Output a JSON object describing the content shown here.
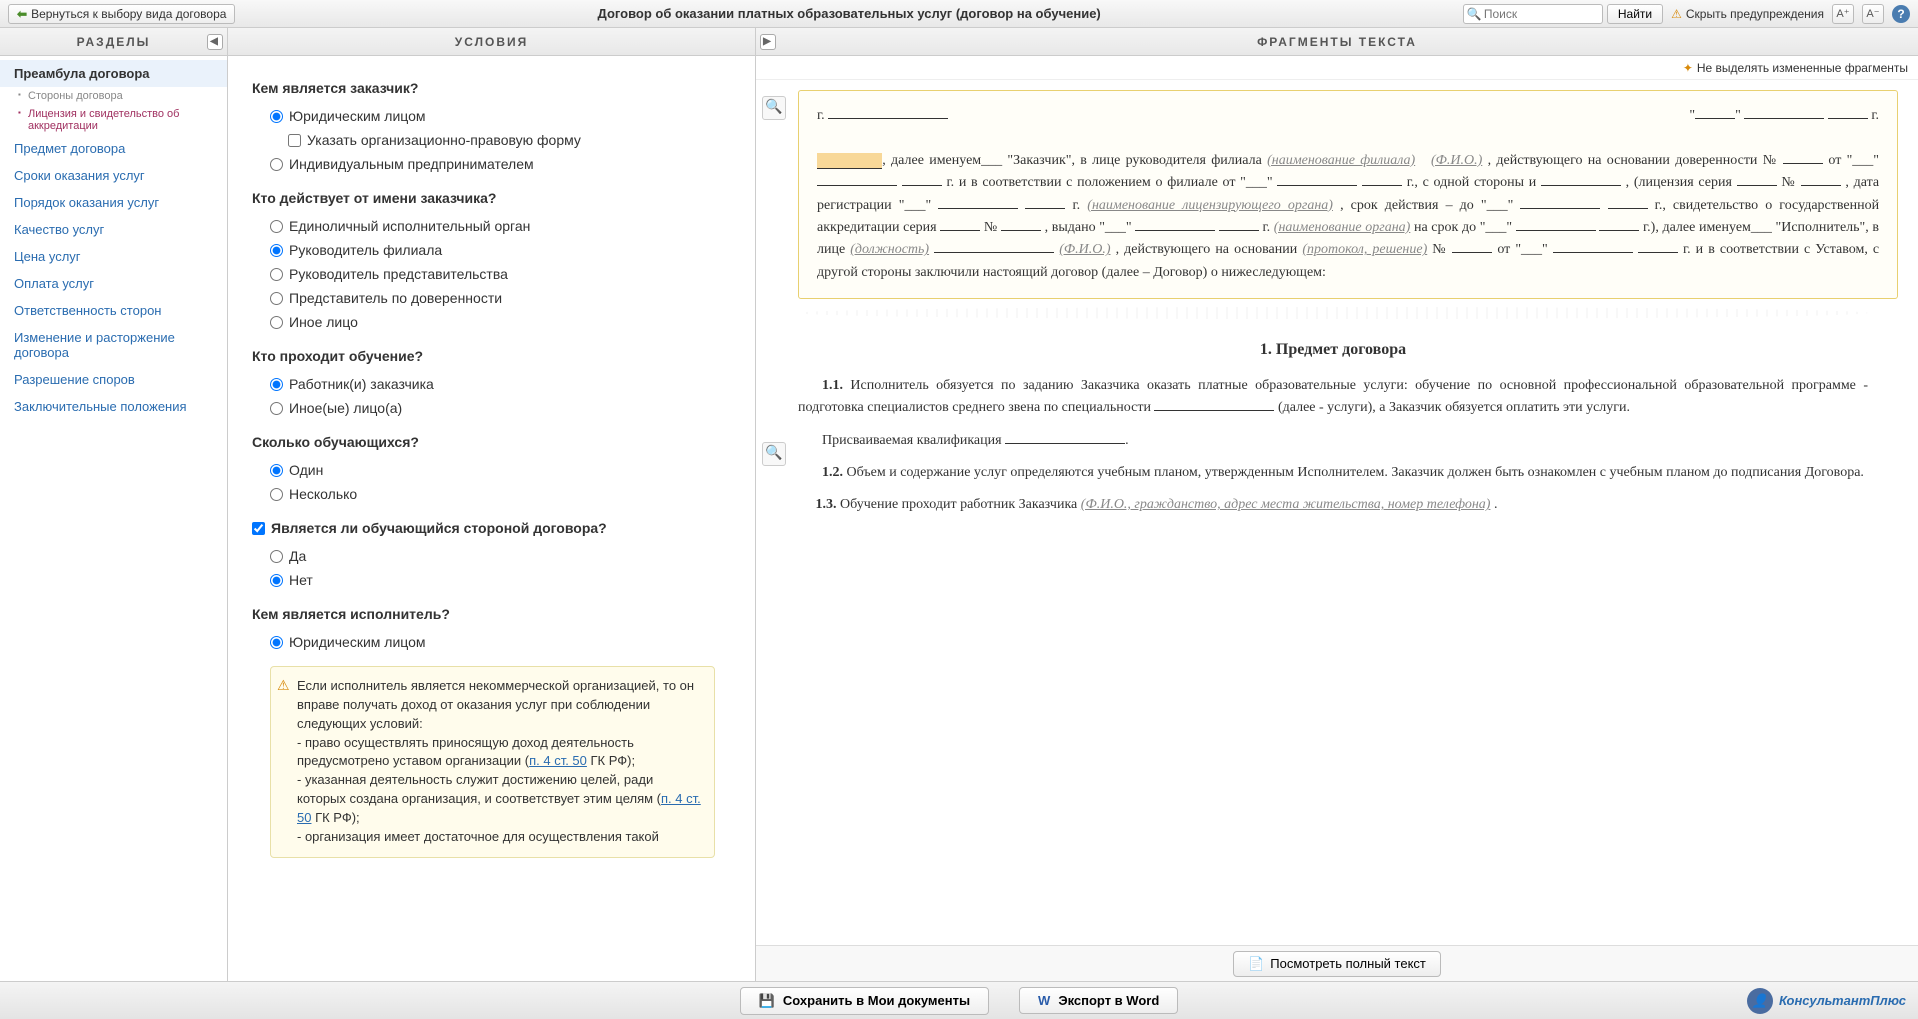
{
  "toolbar": {
    "back": "Вернуться к выбору вида договора",
    "title": "Договор об оказании платных образовательных услуг (договор на обучение)",
    "search_placeholder": "Поиск",
    "find": "Найти",
    "hide_warnings": "Скрыть предупреждения"
  },
  "panels": {
    "sections": "РАЗДЕЛЫ",
    "conditions": "УСЛОВИЯ",
    "fragments": "ФРАГМЕНТЫ ТЕКСТА"
  },
  "sections": {
    "items": [
      {
        "label": "Преамбула договора",
        "active": true
      },
      {
        "label": "Предмет договора"
      },
      {
        "label": "Сроки оказания услуг"
      },
      {
        "label": "Порядок оказания услуг"
      },
      {
        "label": "Качество услуг"
      },
      {
        "label": "Цена услуг"
      },
      {
        "label": "Оплата услуг"
      },
      {
        "label": "Ответственность сторон"
      },
      {
        "label": "Изменение и расторжение договора"
      },
      {
        "label": "Разрешение споров"
      },
      {
        "label": "Заключительные положения"
      }
    ],
    "subsections": [
      {
        "label": "Стороны договора"
      },
      {
        "label": "Лицензия и свидетельство об аккредитации",
        "active": true
      }
    ]
  },
  "conditions": {
    "q1": "Кем является заказчик?",
    "q1_opts": [
      "Юридическим лицом",
      "Индивидуальным предпринимателем"
    ],
    "q1_sub": "Указать организационно-правовую форму",
    "q2": "Кто действует от имени заказчика?",
    "q2_opts": [
      "Единоличный исполнительный орган",
      "Руководитель филиала",
      "Руководитель представительства",
      "Представитель по доверенности",
      "Иное лицо"
    ],
    "q3": "Кто проходит обучение?",
    "q3_opts": [
      "Работник(и) заказчика",
      "Иное(ые) лицо(а)"
    ],
    "q4": "Сколько обучающихся?",
    "q4_opts": [
      "Один",
      "Несколько"
    ],
    "q5": "Является ли обучающийся стороной договора?",
    "q5_opts": [
      "Да",
      "Нет"
    ],
    "q6": "Кем является исполнитель?",
    "q6_opts": [
      "Юридическим лицом"
    ],
    "warning": {
      "intro": "Если исполнитель является некоммерческой организацией, то он вправе получать доход от оказания услуг при соблюдении следующих условий:",
      "li1": "- право осуществлять приносящую доход деятельность предусмотрено уставом организации (",
      "link1": "п. 4 ст. 50",
      "li1_end": " ГК РФ);",
      "li2": "- указанная деятельность служит достижению целей, ради которых создана организация, и соответствует этим целям (",
      "link2": "п. 4 ст. 50",
      "li2_end": " ГК РФ);",
      "li3": "- организация имеет достаточное для осуществления такой"
    }
  },
  "fragments": {
    "no_highlight": "Не выделять измененные фрагменты",
    "city_prefix": "г.",
    "year_suffix": "г.",
    "t1": ", далее именуем___ \"Заказчик\", в лице руководителя филиала",
    "ph_branch": "(наименование филиала)",
    "ph_fio": "(Ф.И.О.)",
    "t2": ", действующего на основании доверенности №",
    "t2a": "от \"___\"",
    "t2b": "г. и  в соответствии с положением о филиале от \"___\"",
    "t2c": "г., с одной стороны и",
    "t2d": ", (лицензия серия",
    "t2e": "№",
    "t2f": ", дата регистрации \"___\"",
    "t2g": "г.",
    "ph_license": "(наименование лицензирующего органа)",
    "t3": ", срок действия – до \"___\"",
    "t3a": "г., свидетельство о государственной аккредитации серия",
    "t3b": "№",
    "t3c": ", выдано \"___\"",
    "t3d": "г.",
    "ph_organ": "(наименование органа)",
    "t4": "на срок до \"___\"",
    "t4a": "г.), далее  именуем___ \"Исполнитель\", в лице",
    "ph_position": "(должность)",
    "t5": ", действующего на основании",
    "ph_protocol": "(протокол, решение)",
    "t5a": "№",
    "t5b": "от \"___\"",
    "t5c": "г. и в соответствии с Уставом, с другой стороны заключили настоящий договор (далее – Договор) о нижеследующем:",
    "section1": "1. Предмет договора",
    "p11_lead": "1.1.",
    "p11": " Исполнитель обязуется по заданию Заказчика оказать платные образовательные услуги: обучение по основной профессиональной образовательной программе - подготовка специалистов среднего звена по специальности ",
    "p11_end": " (далее - услуги), а Заказчик обязуется оплатить эти услуги.",
    "p11_qual": "Присваиваемая квалификация ",
    "p12_lead": "1.2.",
    "p12": " Объем и содержание услуг определяются учебным планом, утвержденным Исполнителем. Заказчик должен быть ознакомлен с учебным планом до подписания Договора.",
    "p13_lead": "1.3.",
    "p13": " Обучение проходит работник Заказчика ",
    "p13_ph": "(Ф.И.О., гражданство, адрес места жительства, номер телефона)",
    "view_full": "Посмотреть полный текст"
  },
  "bottom": {
    "save": "Сохранить в Мои документы",
    "export": "Экспорт в Word",
    "logo": "КонсультантПлюс"
  }
}
